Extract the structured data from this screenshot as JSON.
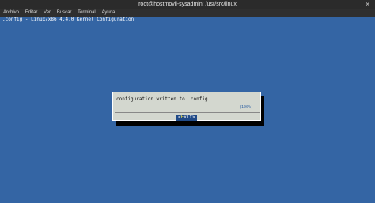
{
  "window": {
    "title": "root@hostmovil-sysadmin: /usr/src/linux",
    "close_symbol": "✕"
  },
  "menubar": {
    "items": [
      "Archivo",
      "Editar",
      "Ver",
      "Buscar",
      "Terminal",
      "Ayuda"
    ]
  },
  "terminal": {
    "config_title": ".config - Linux/x86 4.4.0 Kernel Configuration",
    "dialog": {
      "message": "configuration written to .config",
      "percent": "(100%)",
      "exit_button": {
        "left_bracket": "<",
        "hotkey": "E",
        "rest": "xit",
        "right_bracket": ">"
      }
    }
  },
  "colors": {
    "background": "#3465a4",
    "dialog": "#d3d7cf",
    "titlebar": "#2b2b2b"
  }
}
